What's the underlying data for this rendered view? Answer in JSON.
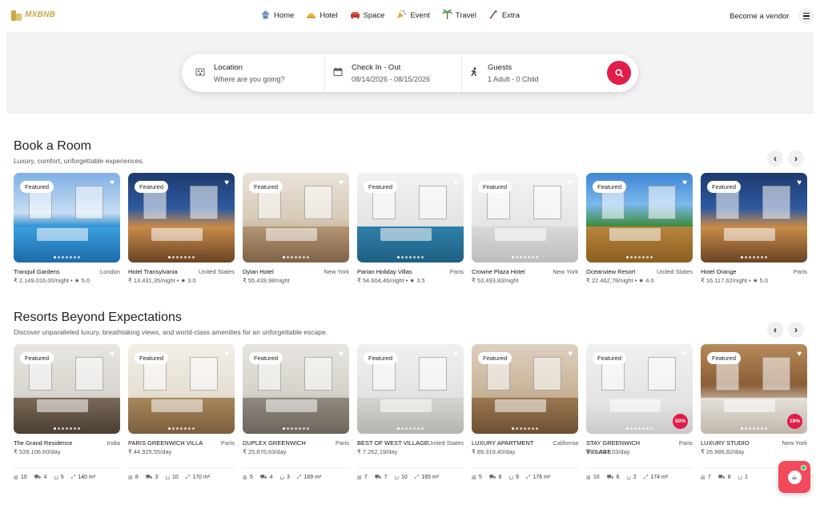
{
  "brand": {
    "name": "MXBNB"
  },
  "nav": {
    "items": [
      {
        "label": "Home",
        "icon": "house-icon"
      },
      {
        "label": "Hotel",
        "icon": "hotel-bell-icon"
      },
      {
        "label": "Space",
        "icon": "sofa-icon"
      },
      {
        "label": "Event",
        "icon": "party-icon"
      },
      {
        "label": "Travel",
        "icon": "palm-tree-icon"
      },
      {
        "label": "Extra",
        "icon": "extra-icon"
      }
    ],
    "vendor_label": "Become a vendor"
  },
  "search": {
    "location": {
      "label": "Location",
      "placeholder": "Where are you going?"
    },
    "dates": {
      "label": "Check In - Out",
      "value": "08/14/2026 - 08/15/2026"
    },
    "guests": {
      "label": "Guests",
      "value": "1 Adult - 0 Child"
    }
  },
  "sections": [
    {
      "title": "Book a Room",
      "subtitle": "Luxury, comfort, unforgettable experiences.",
      "cards": [
        {
          "badge": "Featured",
          "name": "Tranquil Gardens",
          "location": "London",
          "price": "₹ 2.149.016,00/night",
          "rating": "• ★ 5.0"
        },
        {
          "badge": "Featured",
          "name": "Hotel Transylvania",
          "location": "United States",
          "price": "₹ 13.431,35/night",
          "rating": "• ★ 3.0"
        },
        {
          "badge": "Featured",
          "name": "Dylan Hotel",
          "location": "New York",
          "price": "₹ 55.439,98/night",
          "rating": ""
        },
        {
          "badge": "Featured",
          "name": "Parian Holiday Villas",
          "location": "Paris",
          "price": "₹ 54.604,46/night",
          "rating": "• ★ 3.5"
        },
        {
          "badge": "Featured",
          "name": "Crowne Plaza Hotel",
          "location": "New York",
          "price": "₹ 53.493,83/night",
          "rating": ""
        },
        {
          "badge": "Featured",
          "name": "Oceanview Resort",
          "location": "United States",
          "price": "₹ 22.462,78/night",
          "rating": "• ★ 4.0"
        },
        {
          "badge": "Featured",
          "name": "Hotel Orange",
          "location": "Paris",
          "price": "₹ 16.117,62/night",
          "rating": "• ★ 5.0"
        }
      ]
    },
    {
      "title": "Resorts Beyond Expectations",
      "subtitle": "Discover unparalleled luxury, breathtaking views, and world-class amenities for an unforgettable escape.",
      "cards": [
        {
          "badge": "Featured",
          "name": "The Grand Residence",
          "location": "India",
          "price": "₹ 539.106,60/day",
          "amenities": [
            "10",
            "4",
            "5",
            "140 m²"
          ]
        },
        {
          "badge": "Featured",
          "name": "PARIS GREENWICH VILLA",
          "location": "Paris",
          "price": "₹ 44.925,55/day",
          "amenities": [
            "8",
            "3",
            "10",
            "170 m²"
          ]
        },
        {
          "badge": "Featured",
          "name": "DUPLEX GREENWICH",
          "location": "Paris",
          "price": "₹ 25.870,63/day",
          "amenities": [
            "5",
            "4",
            "3",
            "169 m²"
          ]
        },
        {
          "badge": "Featured",
          "name": "BEST OF WEST VILLAGE",
          "location": "United States",
          "price": "₹ 7.262,19/day",
          "amenities": [
            "7",
            "7",
            "10",
            "165 m²"
          ]
        },
        {
          "badge": "Featured",
          "name": "LUXURY APARTMENT",
          "location": "California",
          "price": "₹ 89.319,40/day",
          "amenities": [
            "5",
            "8",
            "9",
            "176 m²"
          ]
        },
        {
          "badge": "Featured",
          "name": "STAY GREENWICH VILLAGE",
          "location": "Paris",
          "price": "₹ 20.147,03/day",
          "discount": "50%",
          "amenities": [
            "10",
            "6",
            "2",
            "174 m²"
          ]
        },
        {
          "badge": "Featured",
          "name": "LUXURY STUDIO",
          "location": "New York",
          "price": "₹ 26.986,82/day",
          "discount": "19%",
          "amenities": [
            "7",
            "8",
            "1",
            ""
          ]
        }
      ]
    }
  ],
  "colors": {
    "accent": "#e11d48",
    "brand": "#c9a646"
  }
}
